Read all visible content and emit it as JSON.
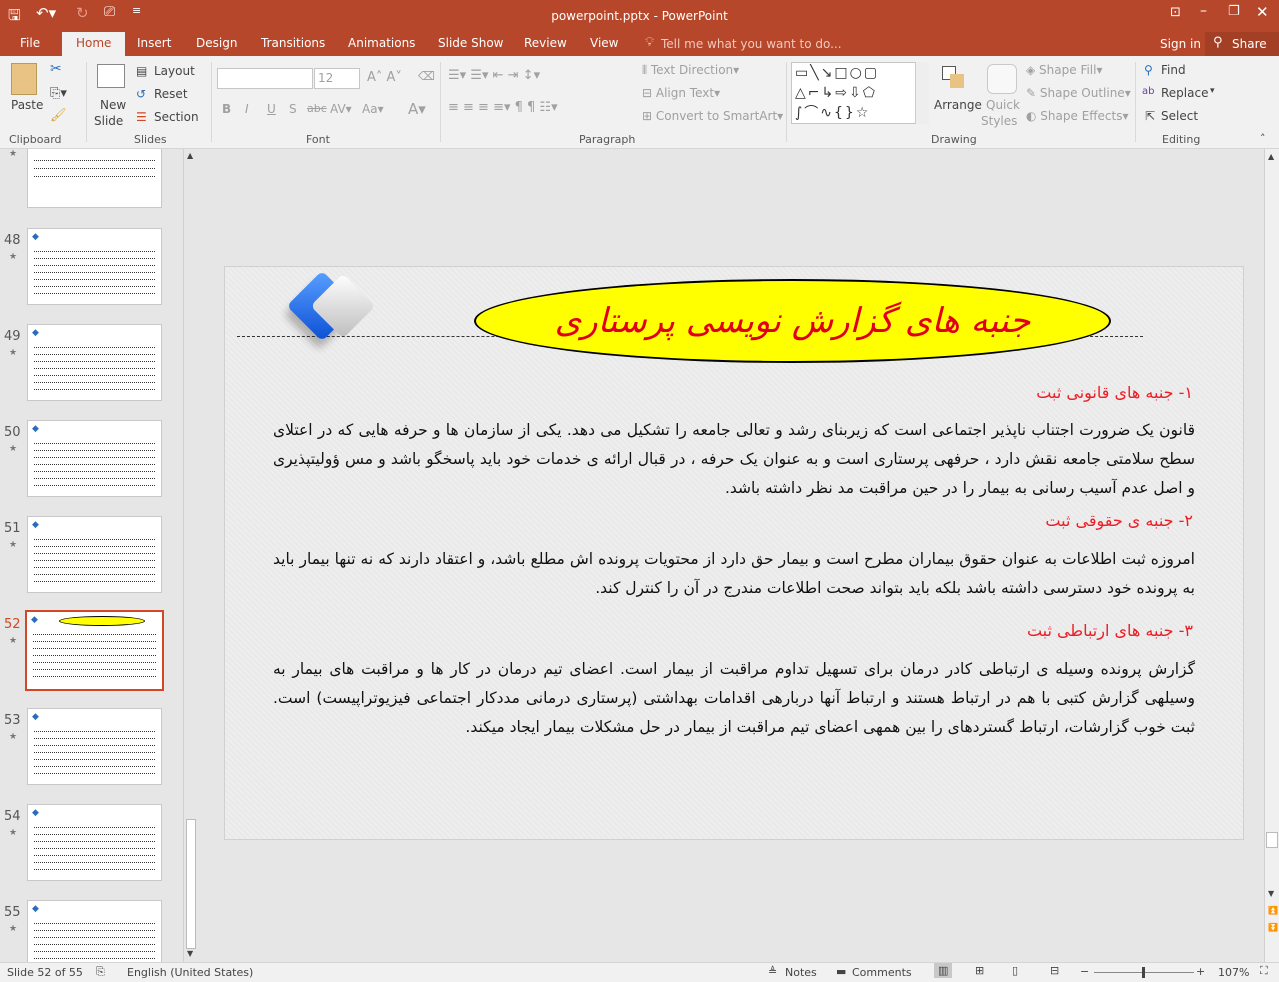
{
  "window": {
    "title": "powerpoint.pptx - PowerPoint"
  },
  "tabs": [
    {
      "label": "File"
    },
    {
      "label": "Home"
    },
    {
      "label": "Insert"
    },
    {
      "label": "Design"
    },
    {
      "label": "Transitions"
    },
    {
      "label": "Animations"
    },
    {
      "label": "Slide Show"
    },
    {
      "label": "Review"
    },
    {
      "label": "View"
    }
  ],
  "tell_me": "Tell me what you want to do...",
  "sign_in": "Sign in",
  "share": "Share",
  "ribbon": {
    "paste": "Paste",
    "clipboard": "Clipboard",
    "new_slide_1": "New",
    "new_slide_2": "Slide",
    "layout": "Layout",
    "reset": "Reset",
    "section": "Section",
    "slides": "Slides",
    "font_size": "12",
    "font": "Font",
    "paragraph": "Paragraph",
    "text_direction": "Text Direction",
    "align_text": "Align Text",
    "convert_smartart": "Convert to SmartArt",
    "arrange": "Arrange",
    "quick_styles_1": "Quick",
    "quick_styles_2": "Styles",
    "shape_fill": "Shape Fill",
    "shape_outline": "Shape Outline",
    "shape_effects": "Shape Effects",
    "drawing": "Drawing",
    "find": "Find",
    "replace": "Replace",
    "select": "Select",
    "editing": "Editing"
  },
  "thumbnails": [
    {
      "num": "48"
    },
    {
      "num": "49"
    },
    {
      "num": "50"
    },
    {
      "num": "51"
    },
    {
      "num": "52",
      "selected": true
    },
    {
      "num": "53"
    },
    {
      "num": "54"
    },
    {
      "num": "55"
    }
  ],
  "slide": {
    "title": "جنبه های گزارش نویسی پرستاری",
    "sections": [
      {
        "heading": "۱- جنبه های قانونی ثبت",
        "body": "قانون یک ضرورت اجتناب ناپذیر اجتماعی است که زیربنای رشد و تعالی جامعه را تشکیل می دهد. یکی از سازمان ها و حرفه هایی که در اعتلای سطح سلامتی جامعه نقش دارد ، حرفهی پرستاری است و به عنوان یک حرفه ، در قبال ارائه ی خدمات خود باید پاسخگو باشد و مس ؤولیتپذیری و اصل عدم آسیب رسانی به بیمار را در حین مراقبت مد نظر داشته باشد."
      },
      {
        "heading": "۲- جنبه ی حقوقی ثبت",
        "body": "امروزه ثبت اطلاعات به عنوان حقوق بیماران مطرح است و بیمار حق دارد از محتویات پرونده اش مطلع باشد، و اعتقاد دارند که نه تنها بیمار باید به پرونده خود دسترسی داشته باشد بلکه باید بتواند صحت اطلاعات مندرج در آن را کنترل کند."
      },
      {
        "heading": "۳- جنبه های ارتباطی ثبت",
        "body": "گزارش پرونده وسیله ی ارتباطی کادر درمان برای تسهیل تداوم مراقبت از بیمار است. اعضای تیم درمان در کار ها و مراقبت های بیمار به وسیلهی گزارش کتبی با هم در ارتباط هستند و ارتباط آنها دربارهی اقدامات بهداشتی (پرستاری درمانی مددکار اجتماعی فیزیوتراپیست) است. ثبت خوب گزارشات، ارتباط گستردهای را بین همهی اعضای تیم مراقبت از بیمار در حل مشکلات بیمار ایجاد میکند."
      }
    ]
  },
  "status": {
    "slide_of": "Slide 52 of 55",
    "language": "English (United States)",
    "notes": "Notes",
    "comments": "Comments",
    "zoom": "107%"
  },
  "colors": {
    "accent": "#b7472a",
    "heading_red": "#ee1c25",
    "title_fill": "#ffff00"
  }
}
